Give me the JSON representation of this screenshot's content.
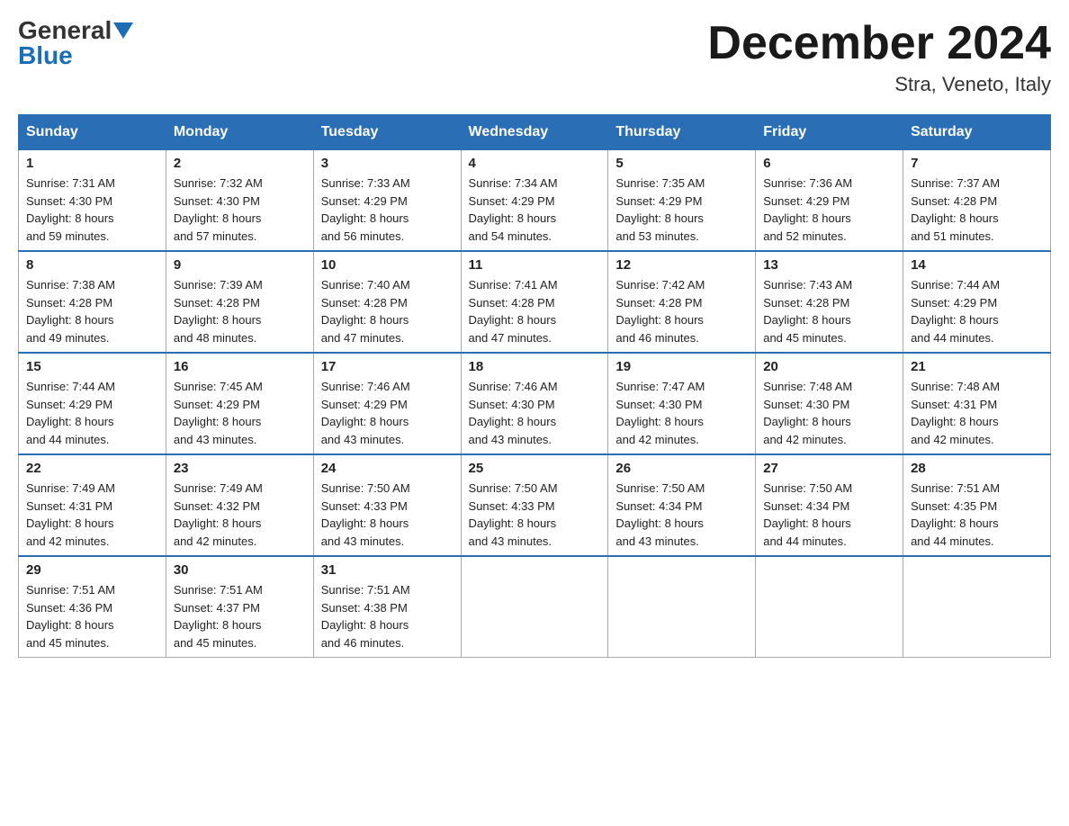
{
  "header": {
    "logo_text1": "General",
    "logo_text2": "Blue",
    "month_title": "December 2024",
    "location": "Stra, Veneto, Italy"
  },
  "weekdays": [
    "Sunday",
    "Monday",
    "Tuesday",
    "Wednesday",
    "Thursday",
    "Friday",
    "Saturday"
  ],
  "weeks": [
    [
      {
        "day": "1",
        "sunrise": "7:31 AM",
        "sunset": "4:30 PM",
        "daylight": "8 hours and 59 minutes."
      },
      {
        "day": "2",
        "sunrise": "7:32 AM",
        "sunset": "4:30 PM",
        "daylight": "8 hours and 57 minutes."
      },
      {
        "day": "3",
        "sunrise": "7:33 AM",
        "sunset": "4:29 PM",
        "daylight": "8 hours and 56 minutes."
      },
      {
        "day": "4",
        "sunrise": "7:34 AM",
        "sunset": "4:29 PM",
        "daylight": "8 hours and 54 minutes."
      },
      {
        "day": "5",
        "sunrise": "7:35 AM",
        "sunset": "4:29 PM",
        "daylight": "8 hours and 53 minutes."
      },
      {
        "day": "6",
        "sunrise": "7:36 AM",
        "sunset": "4:29 PM",
        "daylight": "8 hours and 52 minutes."
      },
      {
        "day": "7",
        "sunrise": "7:37 AM",
        "sunset": "4:28 PM",
        "daylight": "8 hours and 51 minutes."
      }
    ],
    [
      {
        "day": "8",
        "sunrise": "7:38 AM",
        "sunset": "4:28 PM",
        "daylight": "8 hours and 49 minutes."
      },
      {
        "day": "9",
        "sunrise": "7:39 AM",
        "sunset": "4:28 PM",
        "daylight": "8 hours and 48 minutes."
      },
      {
        "day": "10",
        "sunrise": "7:40 AM",
        "sunset": "4:28 PM",
        "daylight": "8 hours and 47 minutes."
      },
      {
        "day": "11",
        "sunrise": "7:41 AM",
        "sunset": "4:28 PM",
        "daylight": "8 hours and 47 minutes."
      },
      {
        "day": "12",
        "sunrise": "7:42 AM",
        "sunset": "4:28 PM",
        "daylight": "8 hours and 46 minutes."
      },
      {
        "day": "13",
        "sunrise": "7:43 AM",
        "sunset": "4:28 PM",
        "daylight": "8 hours and 45 minutes."
      },
      {
        "day": "14",
        "sunrise": "7:44 AM",
        "sunset": "4:29 PM",
        "daylight": "8 hours and 44 minutes."
      }
    ],
    [
      {
        "day": "15",
        "sunrise": "7:44 AM",
        "sunset": "4:29 PM",
        "daylight": "8 hours and 44 minutes."
      },
      {
        "day": "16",
        "sunrise": "7:45 AM",
        "sunset": "4:29 PM",
        "daylight": "8 hours and 43 minutes."
      },
      {
        "day": "17",
        "sunrise": "7:46 AM",
        "sunset": "4:29 PM",
        "daylight": "8 hours and 43 minutes."
      },
      {
        "day": "18",
        "sunrise": "7:46 AM",
        "sunset": "4:30 PM",
        "daylight": "8 hours and 43 minutes."
      },
      {
        "day": "19",
        "sunrise": "7:47 AM",
        "sunset": "4:30 PM",
        "daylight": "8 hours and 42 minutes."
      },
      {
        "day": "20",
        "sunrise": "7:48 AM",
        "sunset": "4:30 PM",
        "daylight": "8 hours and 42 minutes."
      },
      {
        "day": "21",
        "sunrise": "7:48 AM",
        "sunset": "4:31 PM",
        "daylight": "8 hours and 42 minutes."
      }
    ],
    [
      {
        "day": "22",
        "sunrise": "7:49 AM",
        "sunset": "4:31 PM",
        "daylight": "8 hours and 42 minutes."
      },
      {
        "day": "23",
        "sunrise": "7:49 AM",
        "sunset": "4:32 PM",
        "daylight": "8 hours and 42 minutes."
      },
      {
        "day": "24",
        "sunrise": "7:50 AM",
        "sunset": "4:33 PM",
        "daylight": "8 hours and 43 minutes."
      },
      {
        "day": "25",
        "sunrise": "7:50 AM",
        "sunset": "4:33 PM",
        "daylight": "8 hours and 43 minutes."
      },
      {
        "day": "26",
        "sunrise": "7:50 AM",
        "sunset": "4:34 PM",
        "daylight": "8 hours and 43 minutes."
      },
      {
        "day": "27",
        "sunrise": "7:50 AM",
        "sunset": "4:34 PM",
        "daylight": "8 hours and 44 minutes."
      },
      {
        "day": "28",
        "sunrise": "7:51 AM",
        "sunset": "4:35 PM",
        "daylight": "8 hours and 44 minutes."
      }
    ],
    [
      {
        "day": "29",
        "sunrise": "7:51 AM",
        "sunset": "4:36 PM",
        "daylight": "8 hours and 45 minutes."
      },
      {
        "day": "30",
        "sunrise": "7:51 AM",
        "sunset": "4:37 PM",
        "daylight": "8 hours and 45 minutes."
      },
      {
        "day": "31",
        "sunrise": "7:51 AM",
        "sunset": "4:38 PM",
        "daylight": "8 hours and 46 minutes."
      },
      null,
      null,
      null,
      null
    ]
  ],
  "labels": {
    "sunrise": "Sunrise:",
    "sunset": "Sunset:",
    "daylight": "Daylight:"
  }
}
